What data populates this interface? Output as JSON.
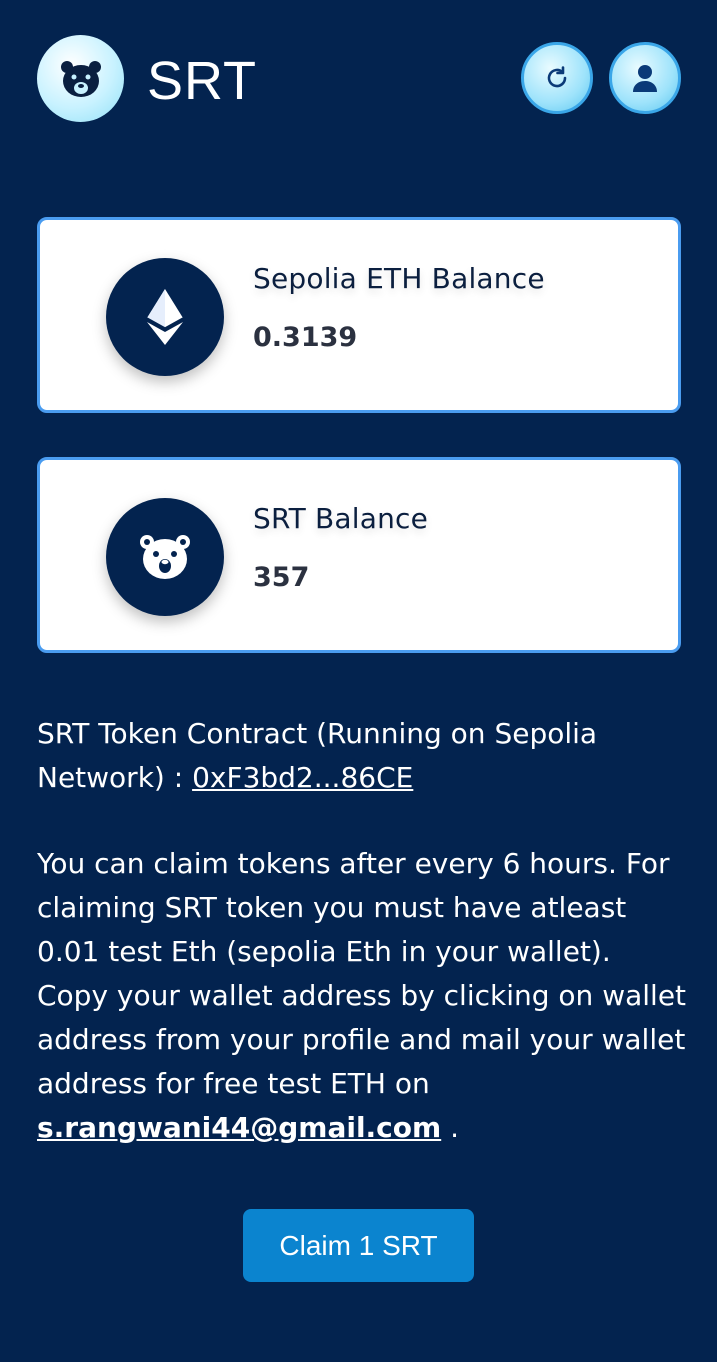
{
  "app": {
    "title": "SRT"
  },
  "header": {
    "logo_icon": "bear-icon",
    "refresh_icon": "refresh-icon",
    "profile_icon": "user-icon"
  },
  "balances": [
    {
      "icon": "ethereum-icon",
      "label": "Sepolia ETH Balance",
      "value": "0.3139"
    },
    {
      "icon": "bear-icon",
      "label": "SRT Balance",
      "value": "357"
    }
  ],
  "contract": {
    "text": "SRT Token Contract (Running on Sepolia Network) : ",
    "address": "0xF3bd2...86CE"
  },
  "info": {
    "text": "You can claim tokens after every 6 hours. For claiming SRT token you must have atleast 0.01 test Eth (sepolia Eth in your wallet). Copy your wallet address by clicking on wallet address from your profile and mail your wallet address for free test ETH on ",
    "email": "s.rangwani44@gmail.com",
    "suffix": " ."
  },
  "claim": {
    "label": "Claim 1 SRT"
  },
  "colors": {
    "background": "#03234f",
    "card": "#ffffff",
    "card_border": "#4a9cf0",
    "button": "#0b84cf"
  }
}
